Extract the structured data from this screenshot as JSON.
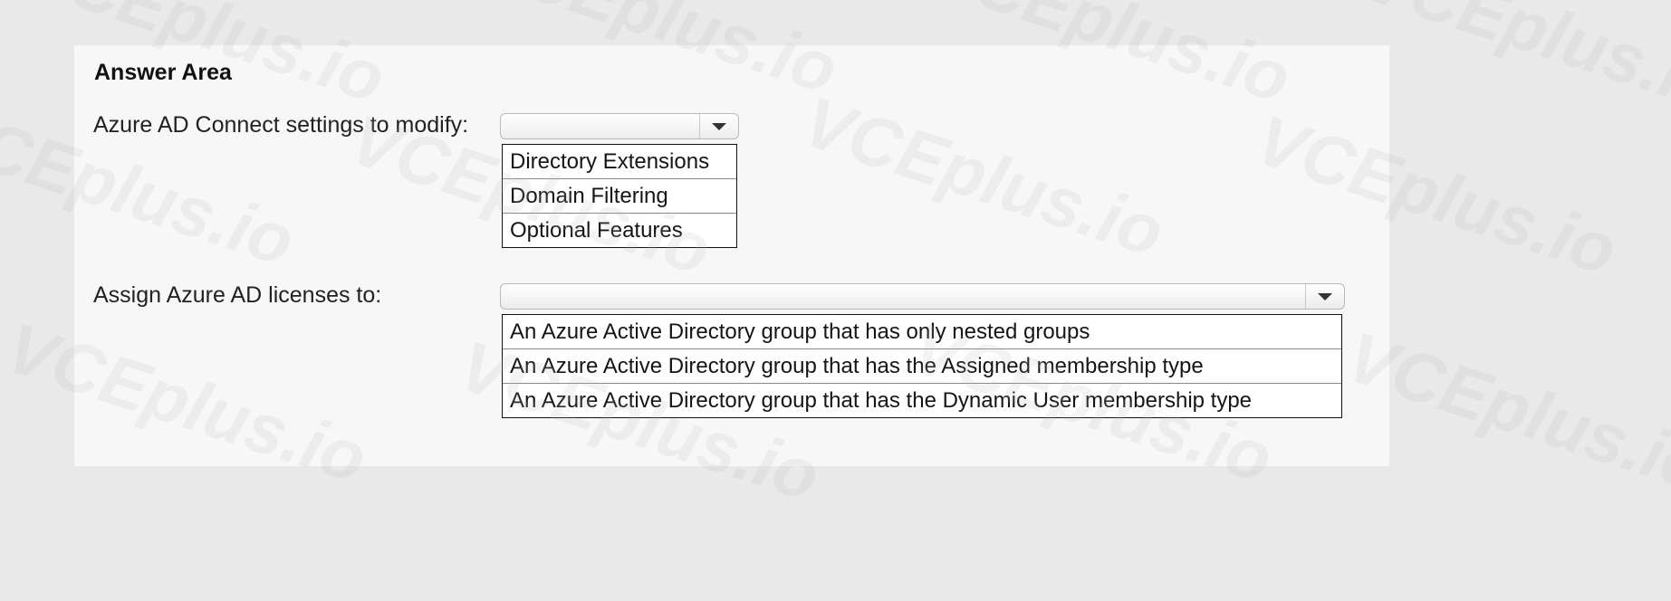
{
  "answer_area": {
    "title": "Answer Area",
    "question1": {
      "label": "Azure AD Connect settings to modify:",
      "selected": "",
      "options": [
        "Directory Extensions",
        "Domain Filtering",
        "Optional Features"
      ]
    },
    "question2": {
      "label": "Assign Azure AD licenses to:",
      "selected": "",
      "options": [
        "An Azure Active Directory group that has only nested groups",
        "An Azure Active Directory group that has the Assigned membership type",
        "An Azure Active Directory group that has the Dynamic User membership type"
      ]
    }
  },
  "watermark": {
    "text": "VCEplus.io"
  }
}
